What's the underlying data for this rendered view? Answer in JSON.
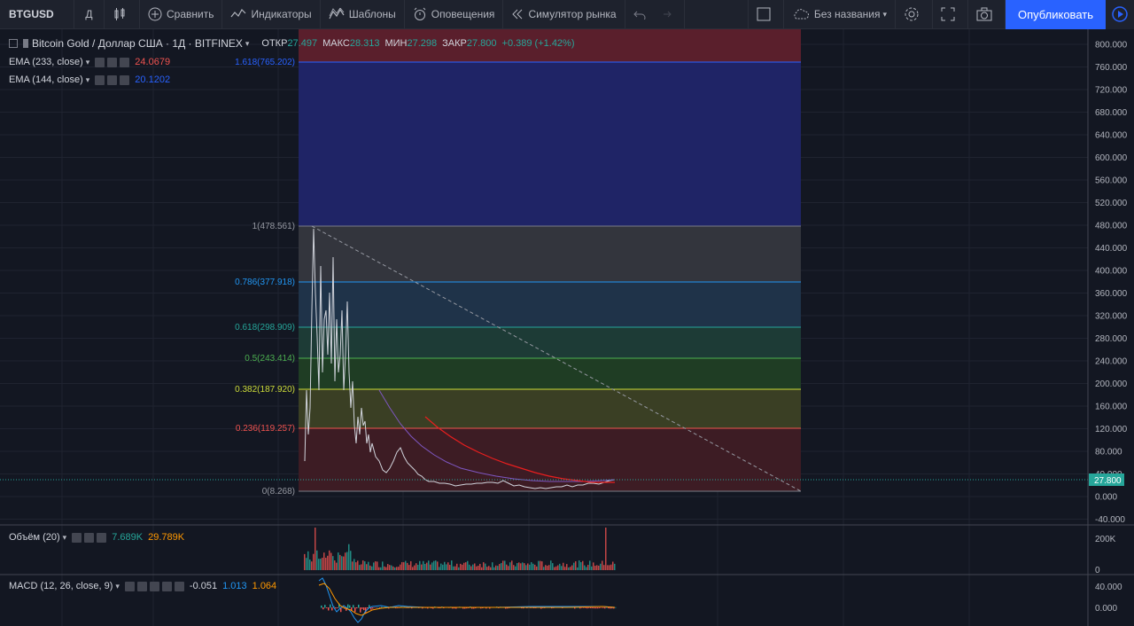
{
  "toolbar": {
    "symbol": "BTGUSD",
    "interval": "Д",
    "compare": "Сравнить",
    "indicators": "Индикаторы",
    "templates": "Шаблоны",
    "alerts": "Оповещения",
    "replay": "Симулятор рынка",
    "layout_name": "Без названия",
    "publish": "Опубликовать"
  },
  "legend": {
    "title": "Bitcoin Gold / Доллар США · 1Д · BITFINEX",
    "open_label": "ОТКР",
    "open": "27.497",
    "high_label": "МАКС",
    "high": "28.313",
    "low_label": "МИН",
    "low": "27.298",
    "close_label": "ЗАКР",
    "close": "27.800",
    "change": "+0.389 (+1.42%)"
  },
  "indicators": {
    "ema233": {
      "label": "EMA (233, close)",
      "value": "24.0679",
      "color": "#ef5350"
    },
    "ema144": {
      "label": "EMA (144, close)",
      "value": "20.1202",
      "color": "#2962ff"
    },
    "volume": {
      "label": "Объём (20)",
      "v1": "7.689K",
      "v2": "29.789K"
    },
    "macd": {
      "label": "MACD (12, 26, close, 9)",
      "v1": "-0.051",
      "v2": "1.013",
      "v3": "1.064"
    }
  },
  "fib_levels": [
    {
      "label": "1.618(765.202)",
      "color": "#2962ff"
    },
    {
      "label": "1(478.561)",
      "color": "#787b86"
    },
    {
      "label": "0.786(377.918)",
      "color": "#2196f3"
    },
    {
      "label": "0.618(298.909)",
      "color": "#26a69a"
    },
    {
      "label": "0.5(243.414)",
      "color": "#4caf50"
    },
    {
      "label": "0.382(187.920)",
      "color": "#cddc39"
    },
    {
      "label": "0.236(119.257)",
      "color": "#ef5350"
    },
    {
      "label": "0(8.268)",
      "color": "#787b86"
    }
  ],
  "price_axis": [
    "800.000",
    "760.000",
    "720.000",
    "680.000",
    "640.000",
    "600.000",
    "560.000",
    "520.000",
    "480.000",
    "440.000",
    "400.000",
    "360.000",
    "320.000",
    "280.000",
    "240.000",
    "200.000",
    "160.000",
    "120.000",
    "80.000",
    "40.000",
    "0.000",
    "-40.000"
  ],
  "last_price": "27.800",
  "volume_axis": [
    "200K",
    "0"
  ],
  "macd_axis": [
    "40.000",
    "0.000"
  ]
}
